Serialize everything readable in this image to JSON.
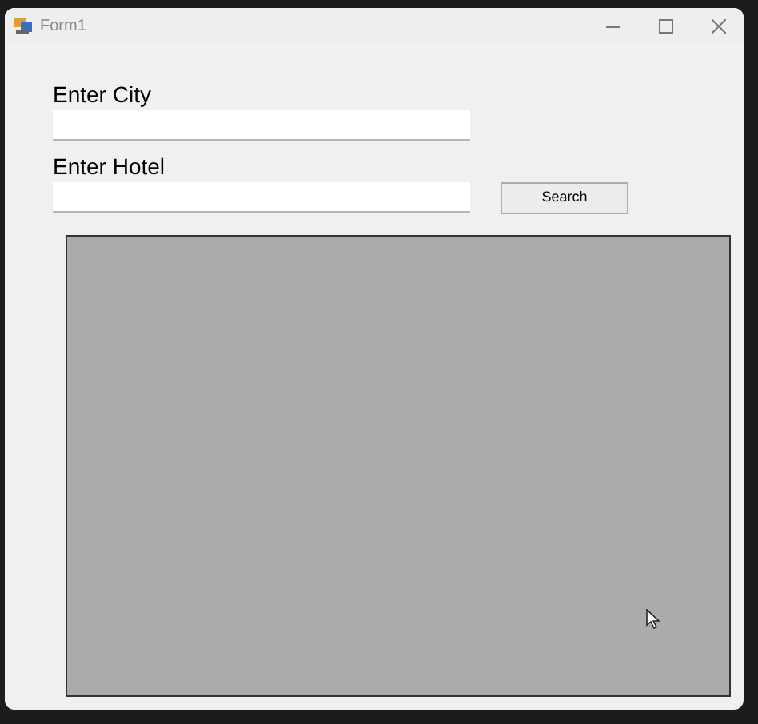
{
  "window": {
    "title": "Form1"
  },
  "fields": [
    {
      "label": "Enter City"
    },
    {
      "label": "Enter Hotel"
    }
  ],
  "search_button": {
    "label": "Search"
  }
}
